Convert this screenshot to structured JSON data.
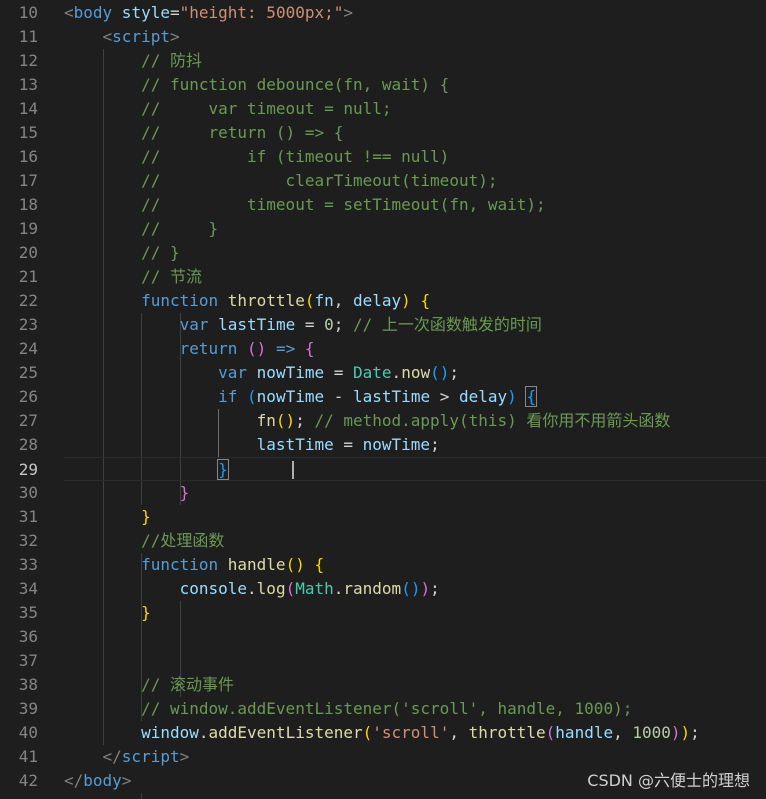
{
  "editor": {
    "theme": {
      "background": "#1e1e1e",
      "line_number_color": "#858585"
    },
    "lines": [
      {
        "n": "10",
        "tokens": [
          [
            "<",
            "punct"
          ],
          [
            "body",
            "tag"
          ],
          [
            " style",
            "attr"
          ],
          [
            "=",
            "op"
          ],
          [
            "\"height: 5000px;\"",
            "str"
          ],
          [
            ">",
            "punct"
          ]
        ]
      },
      {
        "n": "11",
        "tokens": [
          [
            "    "
          ],
          [
            "<",
            "punct"
          ],
          [
            "script",
            "tag"
          ],
          [
            ">",
            "punct"
          ]
        ]
      },
      {
        "n": "12",
        "tokens": [
          [
            "        "
          ],
          [
            "// 防抖",
            "cmt"
          ]
        ]
      },
      {
        "n": "13",
        "tokens": [
          [
            "        "
          ],
          [
            "// function debounce(fn, wait) {",
            "cmt"
          ]
        ]
      },
      {
        "n": "14",
        "tokens": [
          [
            "        "
          ],
          [
            "//     var timeout = null;",
            "cmt"
          ]
        ]
      },
      {
        "n": "15",
        "tokens": [
          [
            "        "
          ],
          [
            "//     return () => {",
            "cmt"
          ]
        ]
      },
      {
        "n": "16",
        "tokens": [
          [
            "        "
          ],
          [
            "//         if (timeout !== null)",
            "cmt"
          ]
        ]
      },
      {
        "n": "17",
        "tokens": [
          [
            "        "
          ],
          [
            "//             clearTimeout(timeout);",
            "cmt"
          ]
        ]
      },
      {
        "n": "18",
        "tokens": [
          [
            "        "
          ],
          [
            "//         timeout = setTimeout(fn, wait);",
            "cmt"
          ]
        ]
      },
      {
        "n": "19",
        "tokens": [
          [
            "        "
          ],
          [
            "//     }",
            "cmt"
          ]
        ]
      },
      {
        "n": "20",
        "tokens": [
          [
            "        "
          ],
          [
            "// }",
            "cmt"
          ]
        ]
      },
      {
        "n": "21",
        "tokens": [
          [
            "        "
          ],
          [
            "// 节流",
            "cmt"
          ]
        ]
      },
      {
        "n": "22",
        "tokens": [
          [
            "        "
          ],
          [
            "function",
            "kw"
          ],
          [
            " "
          ],
          [
            "throttle",
            "fn"
          ],
          [
            "(",
            "b1"
          ],
          [
            "fn",
            "var"
          ],
          [
            ", "
          ],
          [
            "delay",
            "var"
          ],
          [
            ")",
            "b1"
          ],
          [
            " "
          ],
          [
            "{",
            "b1"
          ]
        ]
      },
      {
        "n": "23",
        "tokens": [
          [
            "            "
          ],
          [
            "var",
            "kw"
          ],
          [
            " "
          ],
          [
            "lastTime",
            "var"
          ],
          [
            " = "
          ],
          [
            "0",
            "num"
          ],
          [
            "; "
          ],
          [
            "// 上一次函数触发的时间",
            "cmt"
          ]
        ]
      },
      {
        "n": "24",
        "tokens": [
          [
            "            "
          ],
          [
            "return",
            "kw"
          ],
          [
            " "
          ],
          [
            "()",
            "b2"
          ],
          [
            " "
          ],
          [
            "=>",
            "kw"
          ],
          [
            " "
          ],
          [
            "{",
            "b2"
          ]
        ]
      },
      {
        "n": "25",
        "tokens": [
          [
            "                "
          ],
          [
            "var",
            "kw"
          ],
          [
            " "
          ],
          [
            "nowTime",
            "var"
          ],
          [
            " = "
          ],
          [
            "Date",
            "cls"
          ],
          [
            "."
          ],
          [
            "now",
            "fn"
          ],
          [
            "()",
            "b3"
          ],
          [
            ";"
          ]
        ]
      },
      {
        "n": "26",
        "tokens": [
          [
            "                "
          ],
          [
            "if",
            "kw"
          ],
          [
            " "
          ],
          [
            "(",
            "b3"
          ],
          [
            "nowTime",
            "var"
          ],
          [
            " - "
          ],
          [
            "lastTime",
            "var"
          ],
          [
            " > "
          ],
          [
            "delay",
            "var"
          ],
          [
            ")",
            "b3"
          ],
          [
            " "
          ],
          [
            "{",
            "b3 bracket-box"
          ]
        ]
      },
      {
        "n": "27",
        "tokens": [
          [
            "                    "
          ],
          [
            "fn",
            "fn"
          ],
          [
            "()",
            "b1"
          ],
          [
            "; "
          ],
          [
            "// method.apply(this) 看你用不用箭头函数",
            "cmt"
          ]
        ]
      },
      {
        "n": "28",
        "tokens": [
          [
            "                    "
          ],
          [
            "lastTime",
            "var"
          ],
          [
            " = "
          ],
          [
            "nowTime",
            "var"
          ],
          [
            ";"
          ]
        ]
      },
      {
        "n": "29",
        "tokens": [
          [
            "                "
          ],
          [
            "}",
            "b3 bracket-box"
          ]
        ],
        "current": true
      },
      {
        "n": "30",
        "tokens": [
          [
            "            "
          ],
          [
            "}",
            "b2"
          ]
        ]
      },
      {
        "n": "31",
        "tokens": [
          [
            "        "
          ],
          [
            "}",
            "b1"
          ]
        ]
      },
      {
        "n": "32",
        "tokens": [
          [
            "        "
          ],
          [
            "//处理函数",
            "cmt"
          ]
        ]
      },
      {
        "n": "33",
        "tokens": [
          [
            "        "
          ],
          [
            "function",
            "kw"
          ],
          [
            " "
          ],
          [
            "handle",
            "fn"
          ],
          [
            "()",
            "b1"
          ],
          [
            " "
          ],
          [
            "{",
            "b1"
          ]
        ]
      },
      {
        "n": "34",
        "tokens": [
          [
            "            "
          ],
          [
            "console",
            "var"
          ],
          [
            "."
          ],
          [
            "log",
            "fn"
          ],
          [
            "(",
            "b2"
          ],
          [
            "Math",
            "cls"
          ],
          [
            "."
          ],
          [
            "random",
            "fn"
          ],
          [
            "()",
            "b3"
          ],
          [
            ")",
            "b2"
          ],
          [
            ";"
          ]
        ]
      },
      {
        "n": "35",
        "tokens": [
          [
            "        "
          ],
          [
            "}",
            "b1"
          ]
        ]
      },
      {
        "n": "36",
        "tokens": []
      },
      {
        "n": "37",
        "tokens": []
      },
      {
        "n": "38",
        "tokens": [
          [
            "        "
          ],
          [
            "// 滚动事件",
            "cmt"
          ]
        ]
      },
      {
        "n": "39",
        "tokens": [
          [
            "        "
          ],
          [
            "// window.addEventListener('scroll', handle, 1000);",
            "cmt"
          ]
        ]
      },
      {
        "n": "40",
        "tokens": [
          [
            "        "
          ],
          [
            "window",
            "var"
          ],
          [
            "."
          ],
          [
            "addEventListener",
            "fn"
          ],
          [
            "(",
            "b1"
          ],
          [
            "'scroll'",
            "str"
          ],
          [
            ", "
          ],
          [
            "throttle",
            "fn"
          ],
          [
            "(",
            "b2"
          ],
          [
            "handle",
            "var"
          ],
          [
            ", "
          ],
          [
            "1000",
            "num"
          ],
          [
            ")",
            "b2"
          ],
          [
            ")",
            "b1"
          ],
          [
            ";"
          ]
        ]
      },
      {
        "n": "41",
        "tokens": [
          [
            "    "
          ],
          [
            "</",
            "punct"
          ],
          [
            "script",
            "tag"
          ],
          [
            ">",
            "punct"
          ]
        ]
      },
      {
        "n": "42",
        "tokens": [
          [
            "</",
            "punct"
          ],
          [
            "body",
            "tag"
          ],
          [
            ">",
            "punct"
          ]
        ]
      }
    ]
  },
  "watermark": "CSDN @六便士的理想"
}
